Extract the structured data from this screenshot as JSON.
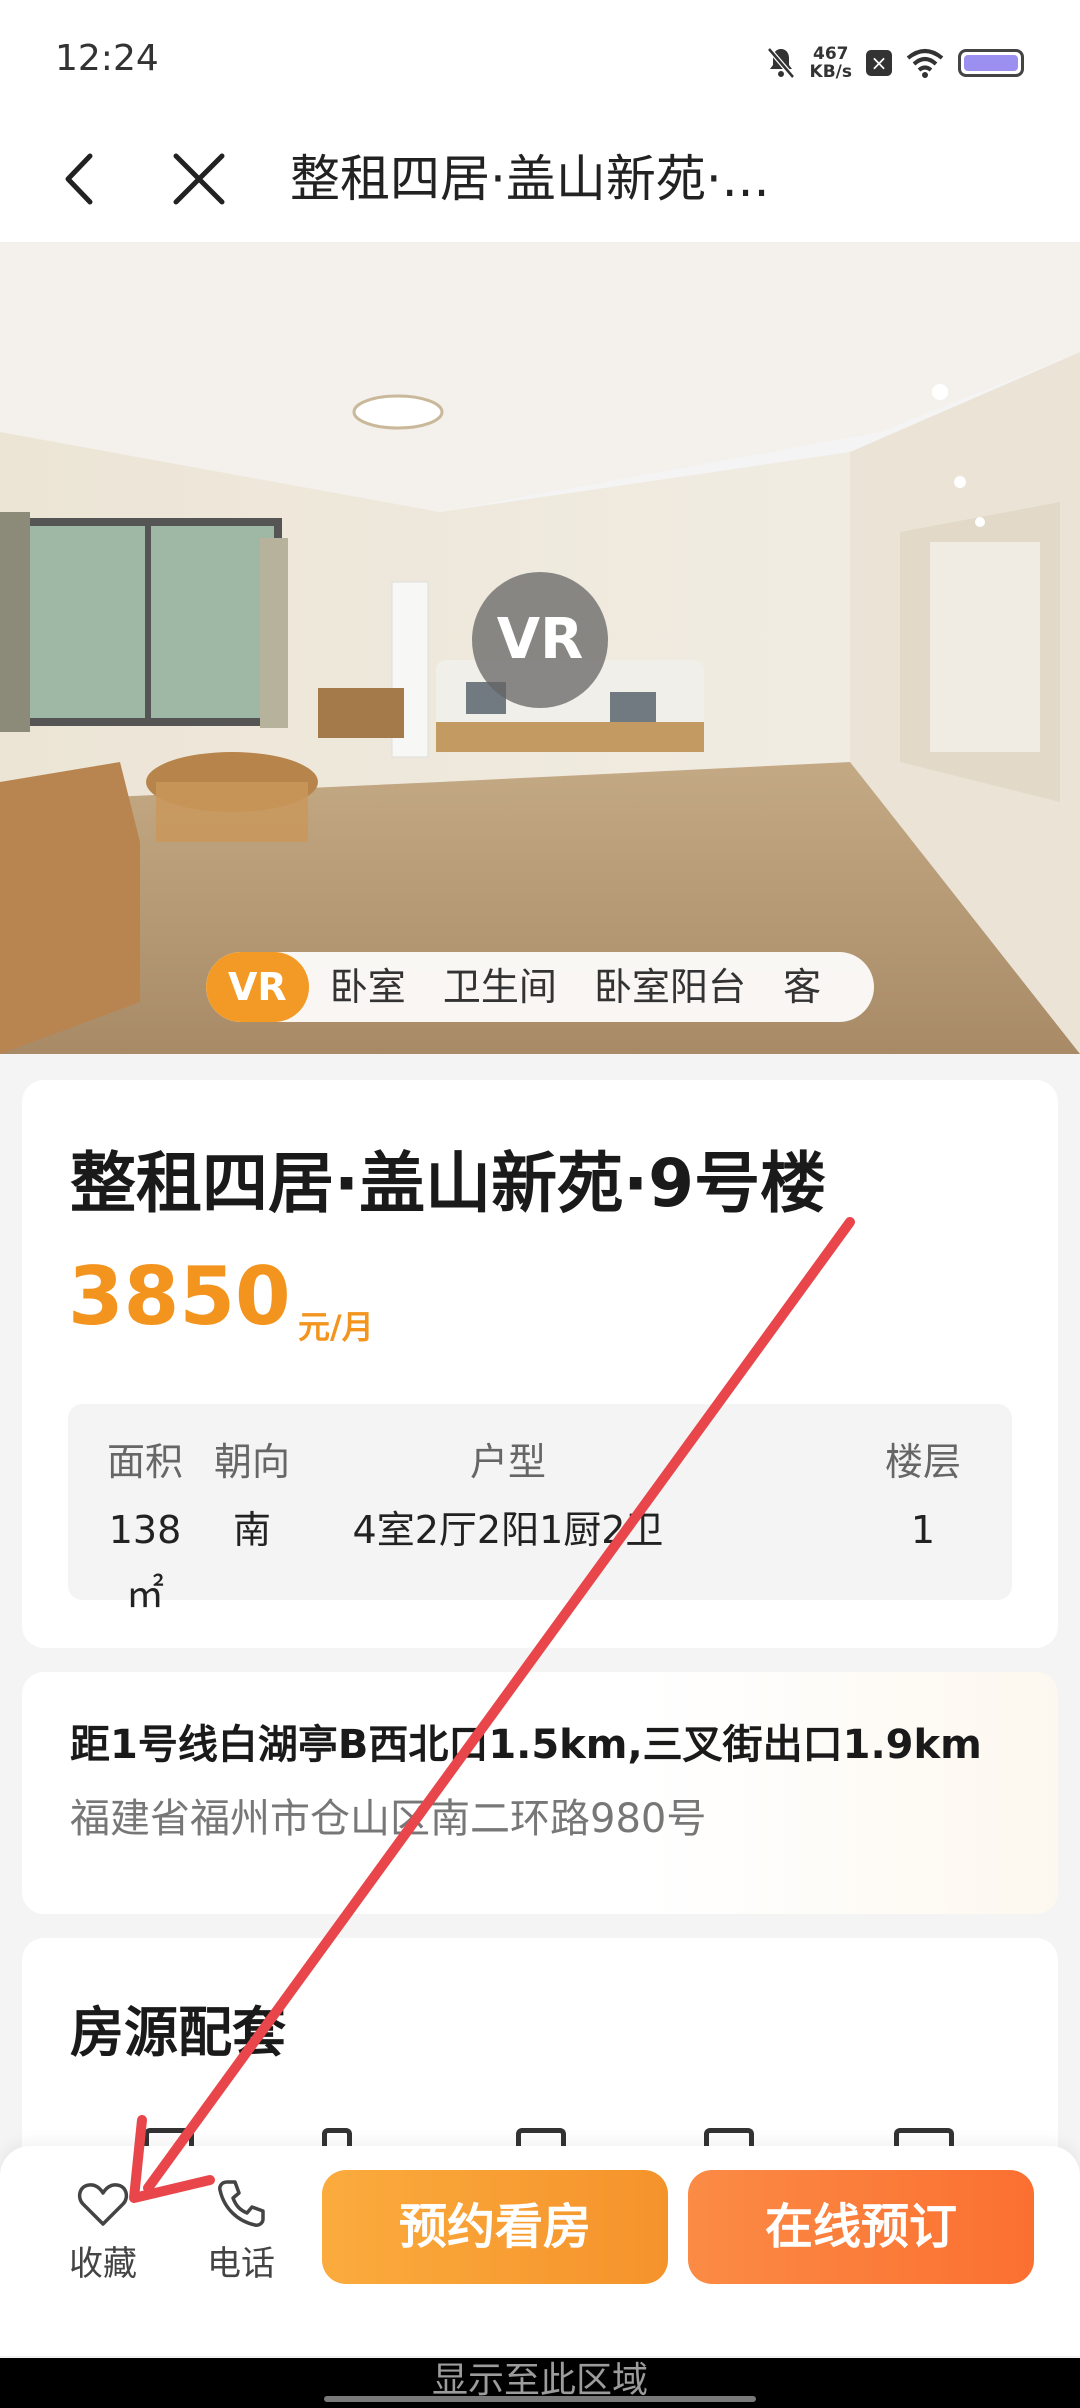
{
  "status_bar": {
    "time": "12:24",
    "net_speed_value": "467",
    "net_speed_unit": "KB/s",
    "icons": [
      "bell-muted-icon",
      "no-sim-icon",
      "wifi-icon",
      "battery-icon"
    ]
  },
  "nav": {
    "title": "整租四居·盖山新苑·...",
    "back_icon": "chevron-left-icon",
    "close_icon": "close-icon"
  },
  "hero": {
    "vr_badge": "VR",
    "photo_tabs": [
      "VR",
      "卧室",
      "卫生间",
      "卧室阳台",
      "客"
    ],
    "active_tab": "VR"
  },
  "listing": {
    "title": "整租四居·盖山新苑·9号楼",
    "price": "3850",
    "price_unit": "元/月",
    "specs": [
      {
        "label": "面积",
        "value": "138㎡"
      },
      {
        "label": "朝向",
        "value": "南"
      },
      {
        "label": "户型",
        "value": "4室2厅2阳1厨2卫"
      },
      {
        "label": "楼层",
        "value": "1"
      }
    ]
  },
  "location": {
    "transit": "距1号线白湖亭B西北口1.5km,三叉街出口1.9km",
    "address": "福建省福州市仓山区南二环路980号"
  },
  "amenities": {
    "title": "房源配套"
  },
  "bottom_bar": {
    "favorite_label": "收藏",
    "phone_label": "电话",
    "view_button": "预约看房",
    "book_button": "在线预订"
  },
  "system": {
    "overlay_text": "显示至此区域"
  },
  "colors": {
    "accent_orange": "#f3941e",
    "annotation_red": "#e8464a"
  }
}
